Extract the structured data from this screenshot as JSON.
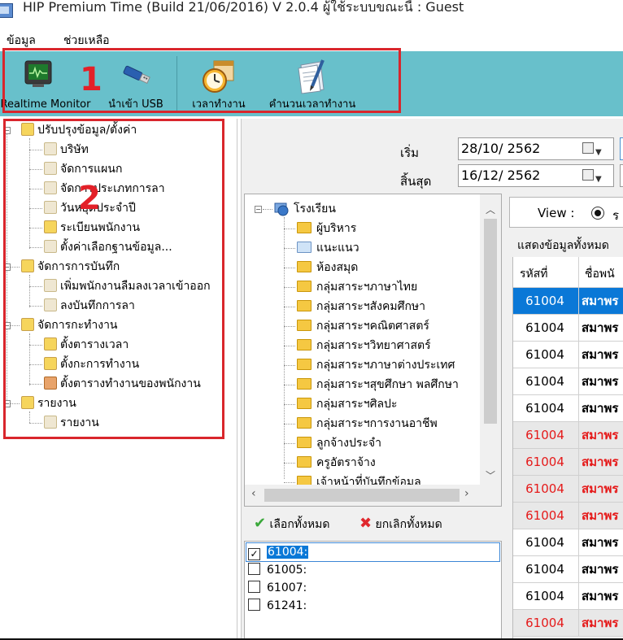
{
  "window": {
    "title": "HIP Premium Time (Build 21/06/2016) V 2.0.4   ผู้ใช้ระบบขณะนี้ : Guest"
  },
  "menu": [
    "ข้อมูล",
    "ช่วยเหลือ"
  ],
  "toolbar": {
    "buttons": [
      {
        "label": "Realtime Monitor",
        "icon": "monitor-icon"
      },
      {
        "label": "นำเข้า USB",
        "icon": "usb-icon"
      },
      {
        "label": "เวลาทำงาน",
        "icon": "clock-calendar-icon"
      },
      {
        "label": "คำนวนเวลาทำงาน",
        "icon": "document-pen-icon"
      }
    ]
  },
  "annotations": {
    "box1": "1",
    "box2": "2"
  },
  "left_tree": {
    "groups": [
      {
        "label": "ปรับปรุงข้อมูล/ตั้งค่า",
        "children": [
          "บริษัท",
          "จัดการแผนก",
          "จัดการประเภทการลา",
          "วันหยุดประจำปี",
          "ระเบียนพนักงาน",
          "ตั้งค่าเลือกฐานข้อมูล..."
        ]
      },
      {
        "label": "จัดการการบันทึก",
        "children": [
          "เพิ่มพนักงานลืมลงเวลาเข้าออก",
          "ลงบันทึกการลา"
        ]
      },
      {
        "label": "จัดการกะทำงาน",
        "children": [
          "ตั้งตารางเวลา",
          "ตั้งกะการทำงาน",
          "ตั้งตารางทำงานของพนักงาน"
        ]
      },
      {
        "label": "รายงาน",
        "children": [
          "รายงาน"
        ]
      }
    ]
  },
  "filters": {
    "start_label": "เริ่ม",
    "start_value": "28/10/ 2562",
    "end_label": "สิ้นสุด",
    "end_value": "16/12/ 2562"
  },
  "org_tree": {
    "root": "โรงเรียน",
    "items": [
      "ผู้บริหาร",
      "แนะแนว",
      "ห้องสมุด",
      "กลุ่มสาระฯภาษาไทย",
      "กลุ่มสาระฯสังคมศึกษา",
      "กลุ่มสาระฯคณิตศาสตร์",
      "กลุ่มสาระฯวิทยาศาสตร์",
      "กลุ่มสาระฯภาษาต่างประเทศ",
      "กลุ่มสาระฯสุขศึกษา พลศึกษา",
      "กลุ่มสาระฯศิลปะ",
      "กลุ่มสาระฯการงานอาชีพ",
      "ลูกจ้างประจำ",
      "ครูอัตราจ้าง",
      "เจ้าหน้าที่บันทึกข้อมูล"
    ]
  },
  "select_bar": {
    "select_all": "เลือกทั้งหมด",
    "deselect_all": "ยกเลิกทั้งหมด"
  },
  "employee_list": [
    {
      "id": "61004:",
      "checked": true
    },
    {
      "id": "61005:",
      "checked": false
    },
    {
      "id": "61007:",
      "checked": false
    },
    {
      "id": "61241:",
      "checked": false
    }
  ],
  "view": {
    "label": "View :",
    "option": "ร"
  },
  "show_all_label": "แสดงข้อมูลทั้งหมด",
  "grid": {
    "headers": [
      "รหัสที่",
      "ชื่อพนั"
    ],
    "rows": [
      {
        "id": "61004",
        "name": "สมาพร",
        "style": "selected"
      },
      {
        "id": "61004",
        "name": "สมาพร",
        "style": "normal"
      },
      {
        "id": "61004",
        "name": "สมาพร",
        "style": "normal"
      },
      {
        "id": "61004",
        "name": "สมาพร",
        "style": "normal"
      },
      {
        "id": "61004",
        "name": "สมาพร",
        "style": "normal"
      },
      {
        "id": "61004",
        "name": "สมาพร",
        "style": "red"
      },
      {
        "id": "61004",
        "name": "สมาพร",
        "style": "red"
      },
      {
        "id": "61004",
        "name": "สมาพร",
        "style": "red"
      },
      {
        "id": "61004",
        "name": "สมาพร",
        "style": "red"
      },
      {
        "id": "61004",
        "name": "สมาพร",
        "style": "normal"
      },
      {
        "id": "61004",
        "name": "สมาพร",
        "style": "normal"
      },
      {
        "id": "61004",
        "name": "สมาพร",
        "style": "normal"
      },
      {
        "id": "61004",
        "name": "สมาพร",
        "style": "red"
      }
    ]
  },
  "colors": {
    "toolbar": "#68c0cb",
    "annotation_red": "#e32028",
    "selected_row": "#0a78d7",
    "red_row_bg": "#e8e8e8",
    "red_text": "#e51a1a"
  }
}
